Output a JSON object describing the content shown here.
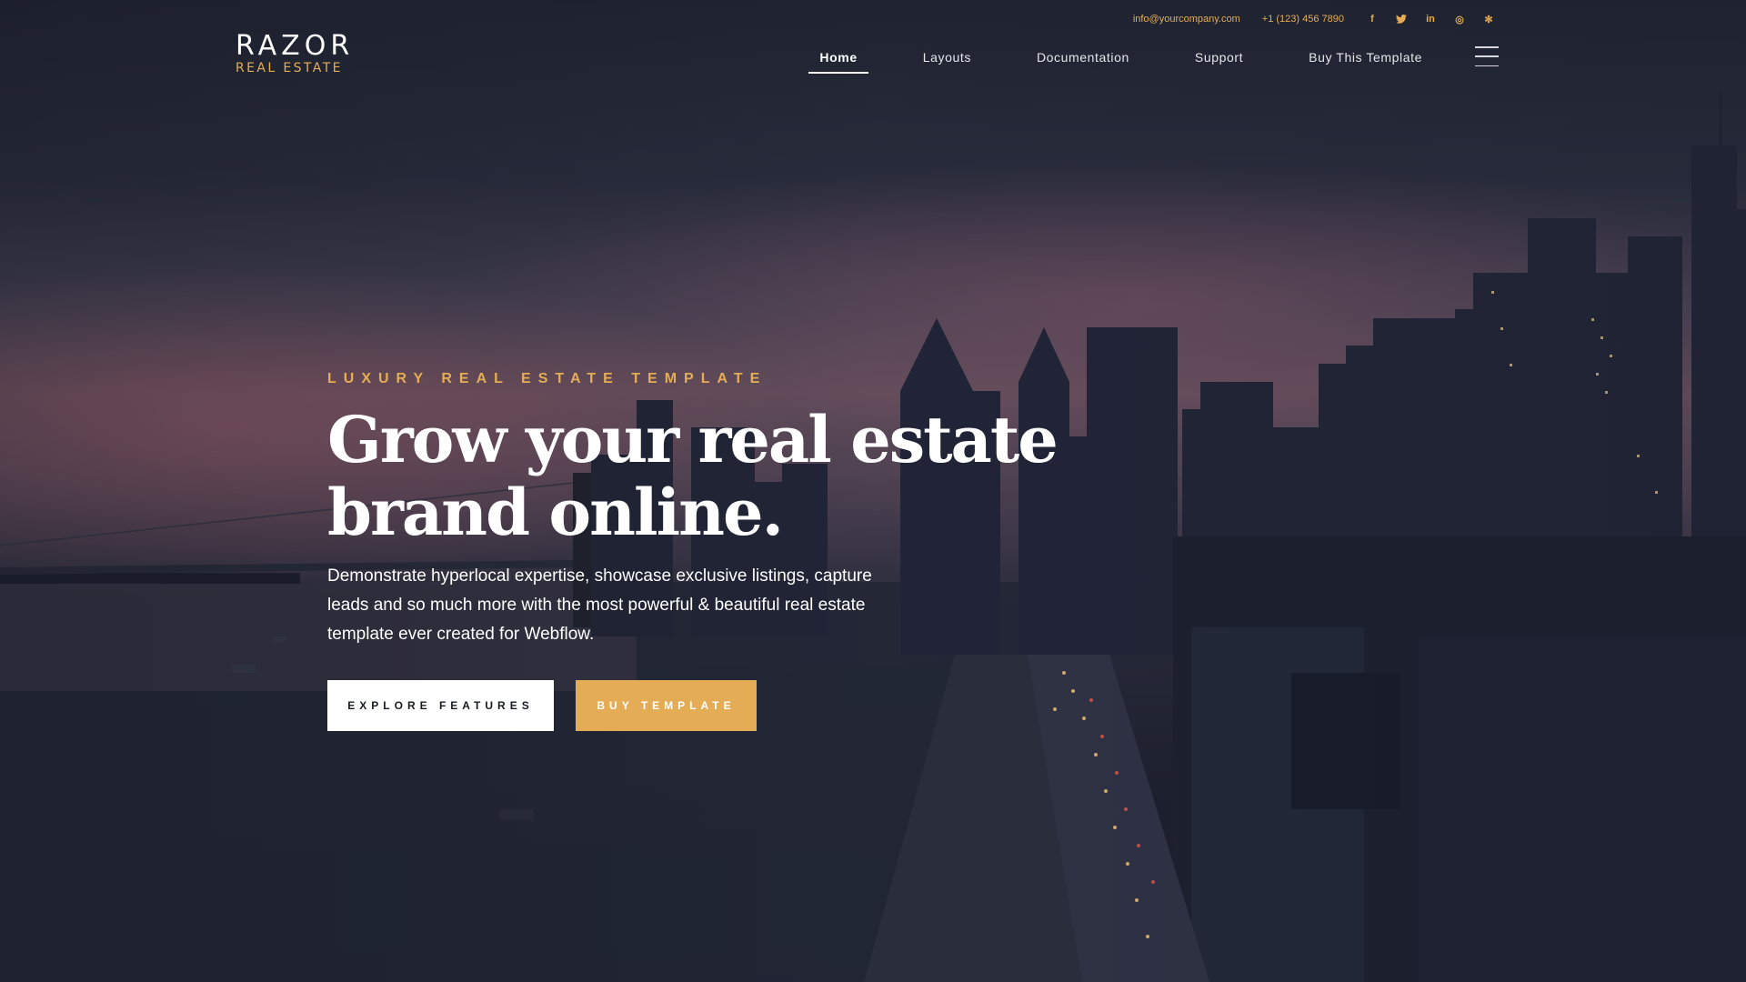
{
  "brand": {
    "name": "RAZOR",
    "tagline": "REAL ESTATE"
  },
  "contact": {
    "email": "info@yourcompany.com",
    "phone": "+1 (123) 456 7890"
  },
  "social": {
    "facebook": "f",
    "twitter": "t",
    "linkedin": "in",
    "instagram": "◎",
    "yelp": "✻"
  },
  "nav": {
    "items": [
      {
        "label": "Home"
      },
      {
        "label": "Layouts"
      },
      {
        "label": "Documentation"
      },
      {
        "label": "Support"
      },
      {
        "label": "Buy This Template"
      }
    ]
  },
  "hero": {
    "eyebrow": "LUXURY REAL ESTATE TEMPLATE",
    "headline": "Grow your real estate brand online.",
    "lead": "Demonstrate hyperlocal expertise, showcase exclusive listings, capture leads and so much more with the most powerful & beautiful real estate template ever created for Webflow.",
    "primary_button": "EXPLORE FEATURES",
    "secondary_button": "BUY TEMPLATE"
  },
  "colors": {
    "accent": "#e4ad55",
    "nav_text": "#e6e6ea",
    "background": "#1b1e2b"
  }
}
